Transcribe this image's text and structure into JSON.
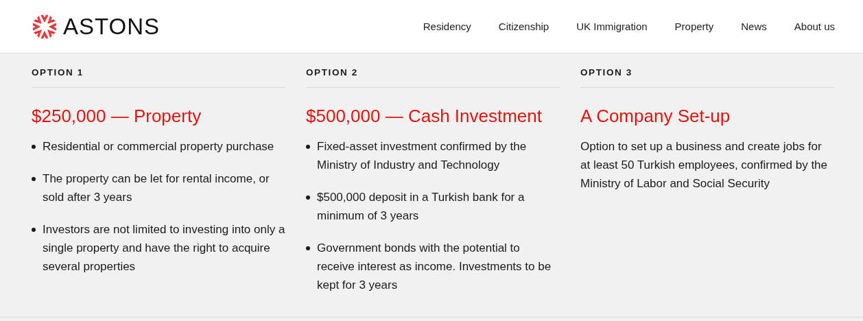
{
  "header": {
    "logo_text": "ASTONS",
    "nav": [
      {
        "label": "Residency"
      },
      {
        "label": "Citizenship"
      },
      {
        "label": "UK Immigration"
      },
      {
        "label": "Property"
      },
      {
        "label": "News"
      },
      {
        "label": "About us"
      }
    ]
  },
  "options": [
    {
      "kind": "list",
      "label": "OPTION 1",
      "title": "$250,000 — Property",
      "items": [
        "Residential or commercial property purchase",
        "The property can be let for rental income, or sold after 3 years",
        "Investors are not limited to investing into only a single property and have the right to acquire several properties"
      ]
    },
    {
      "kind": "list",
      "label": "OPTION 2",
      "title": "$500,000 — Cash Investment",
      "items": [
        "Fixed-asset investment confirmed by the Ministry of Industry and Technology",
        "$500,000 deposit in a Turkish bank for a minimum of 3 years",
        "Government bonds with the potential to receive interest as income. Investments to be kept for 3 years"
      ]
    },
    {
      "kind": "paragraph",
      "label": "OPTION 3",
      "title": "A Company Set-up",
      "text": "Option to set up a business and create jobs for at least 50 Turkish employees, confirmed by the Ministry of Labor and Social Security"
    }
  ]
}
